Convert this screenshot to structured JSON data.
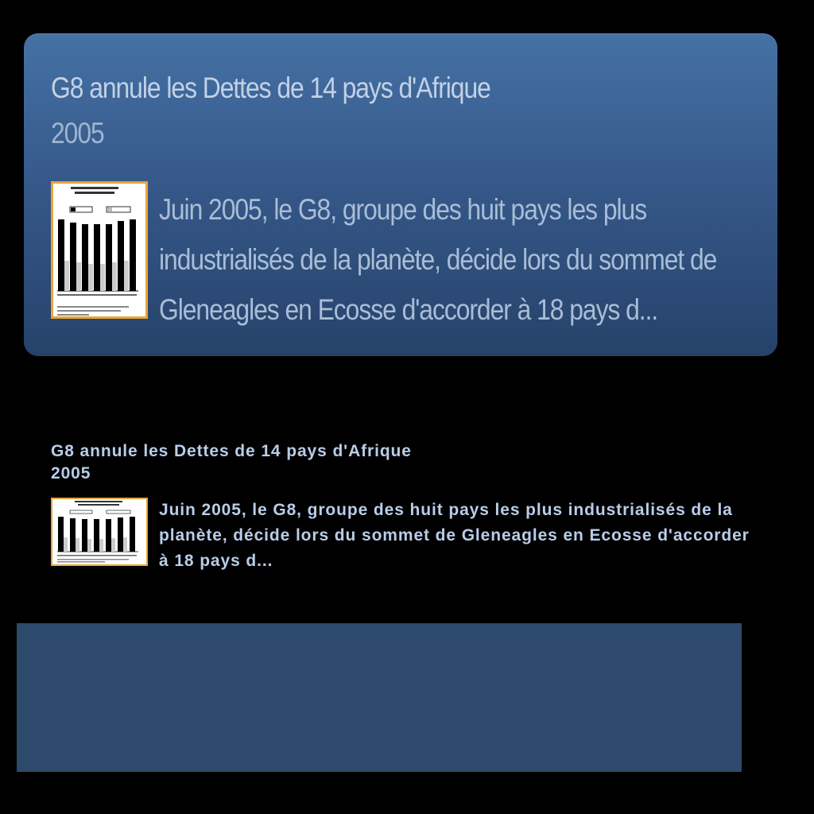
{
  "large_card": {
    "title": "G8 annule les Dettes de 14 pays d'Afrique",
    "year": "2005",
    "description": "Juin 2005, le G8, groupe des huit pays les plus industrialisés de la planète, décide lors du sommet de Gleneagles en Ecosse d'accorder à 18 pays d...",
    "thumbnail_icon": "debt-chart-thumbnail"
  },
  "small_card": {
    "title": "G8 annule les Dettes de 14 pays d'Afrique",
    "year": "2005",
    "description": "Juin 2005, le G8, groupe des huit pays les plus industrialisés de la planète, décide lors du sommet de Gleneagles en Ecosse d'accorder à 18 pays d...",
    "thumbnail_icon": "debt-chart-thumbnail"
  },
  "colors": {
    "card_top": "#4571a4",
    "card_bottom": "#26426a",
    "panel": "#2d4a6d",
    "thumb_border": "#e8a53a"
  }
}
